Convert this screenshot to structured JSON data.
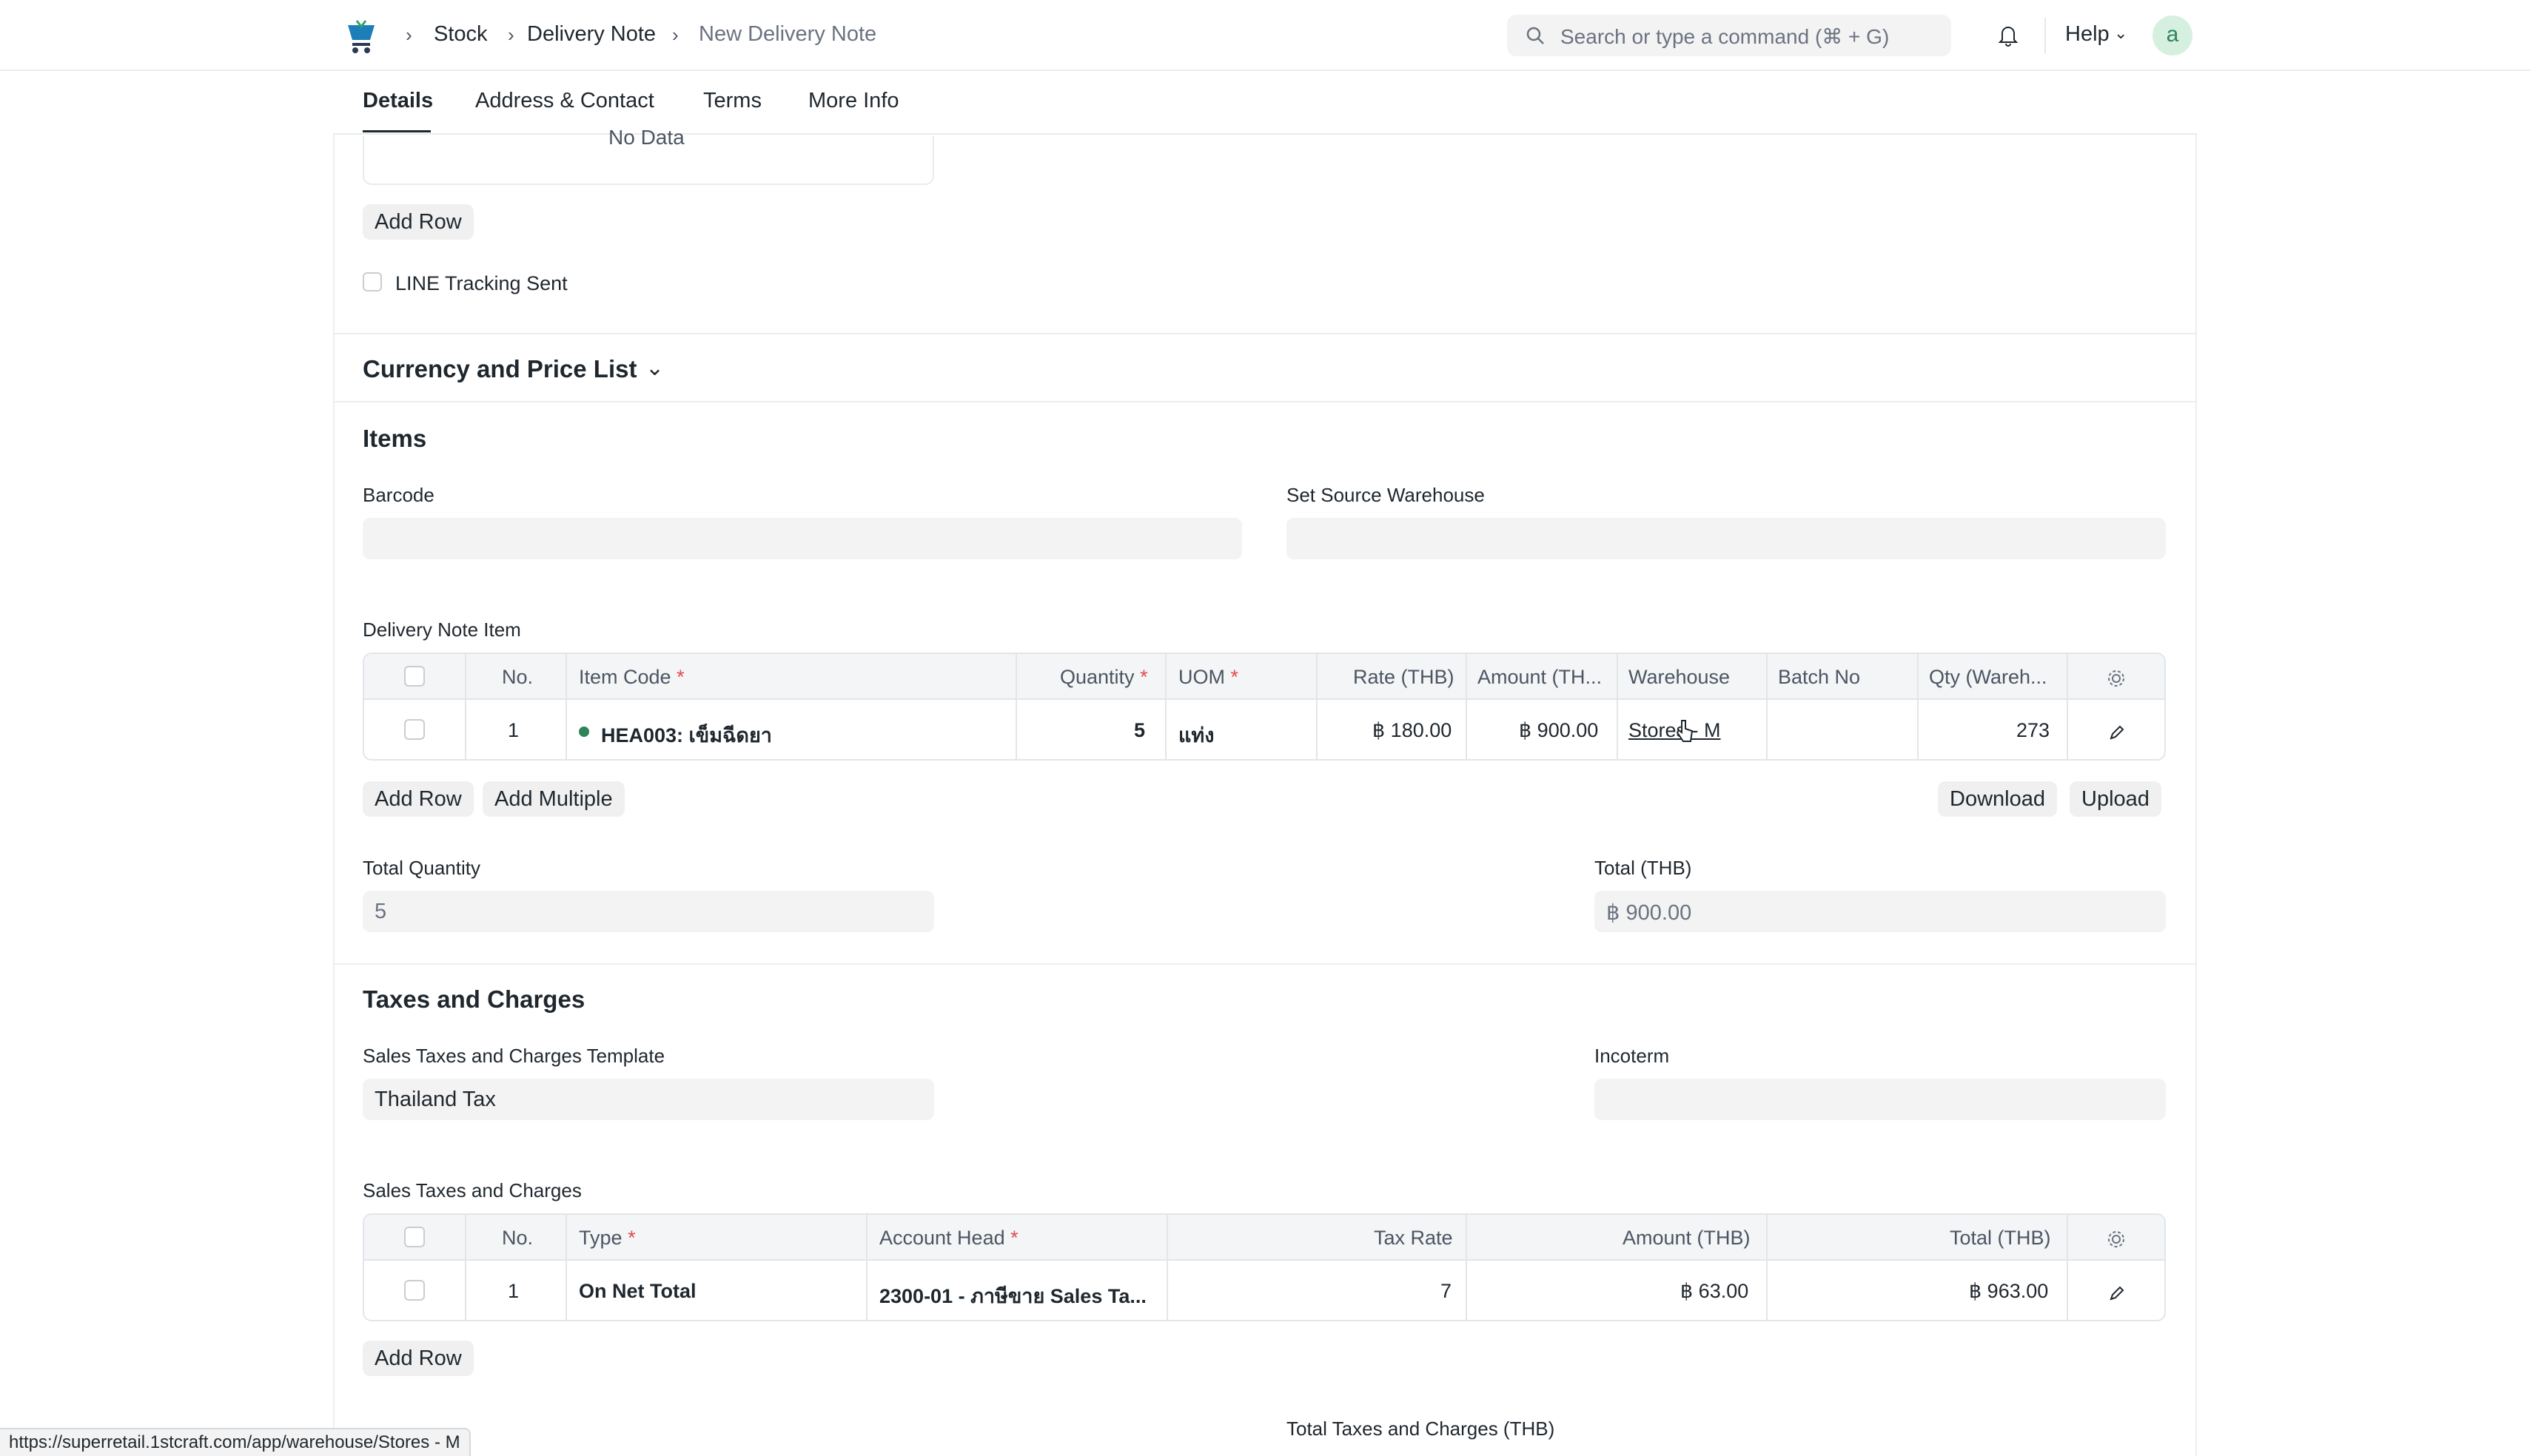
{
  "breadcrumbs": [
    "Stock",
    "Delivery Note",
    "New Delivery Note"
  ],
  "search": {
    "placeholder": "Search or type a command (⌘ + G)"
  },
  "header": {
    "help_label": "Help",
    "avatar_letter": "a"
  },
  "tabs": [
    "Details",
    "Address & Contact",
    "Terms",
    "More Info"
  ],
  "top_section": {
    "empty_text": "No Data",
    "add_row_label": "Add Row",
    "line_tracking_label": "LINE Tracking Sent"
  },
  "currency_section": {
    "title": "Currency and Price List"
  },
  "items_section": {
    "title": "Items",
    "barcode_label": "Barcode",
    "source_warehouse_label": "Set Source Warehouse",
    "grid_label": "Delivery Note Item",
    "columns": {
      "no": "No.",
      "item_code": "Item Code",
      "quantity": "Quantity",
      "uom": "UOM",
      "rate": "Rate (THB)",
      "amount": "Amount (TH...",
      "warehouse": "Warehouse",
      "batch_no": "Batch No",
      "qty_warehouse": "Qty (Wareh..."
    },
    "rows": [
      {
        "no": "1",
        "item_code": "HEA003: เข็มฉีดยา",
        "quantity": "5",
        "uom": "แท่ง",
        "rate": "฿ 180.00",
        "amount": "฿ 900.00",
        "warehouse": "Stores - M",
        "batch_no": "",
        "qty_warehouse": "273"
      }
    ],
    "add_row_label": "Add Row",
    "add_multiple_label": "Add Multiple",
    "download_label": "Download",
    "upload_label": "Upload",
    "total_quantity_label": "Total Quantity",
    "total_quantity_value": "5",
    "total_label": "Total (THB)",
    "total_value": "฿ 900.00"
  },
  "taxes_section": {
    "title": "Taxes and Charges",
    "template_label": "Sales Taxes and Charges Template",
    "template_value": "Thailand Tax",
    "incoterm_label": "Incoterm",
    "grid_label": "Sales Taxes and Charges",
    "columns": {
      "no": "No.",
      "type": "Type",
      "account_head": "Account Head",
      "tax_rate": "Tax Rate",
      "amount": "Amount (THB)",
      "total": "Total (THB)"
    },
    "rows": [
      {
        "no": "1",
        "type": "On Net Total",
        "account_head": "2300-01 - ภาษีขาย Sales Ta...",
        "tax_rate": "7",
        "amount": "฿ 63.00",
        "total": "฿ 963.00"
      }
    ],
    "add_row_label": "Add Row",
    "total_taxes_label": "Total Taxes and Charges (THB)"
  },
  "status_bar": {
    "url": "https://superretail.1stcraft.com/app/warehouse/Stores - M"
  },
  "colors": {
    "accent_green": "#2f855a",
    "required_red": "#e24c4c",
    "field_bg": "#f3f3f3"
  }
}
